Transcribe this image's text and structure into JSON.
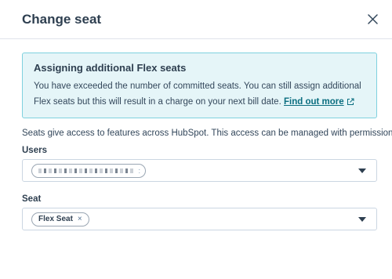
{
  "dialog": {
    "title": "Change seat",
    "close_icon": "close-icon"
  },
  "alert": {
    "title": "Assigning additional Flex seats",
    "body": "You have exceeded the number of committed seats. You can still assign additional Flex seats but this will result in a charge on your next bill date.",
    "link_label": "Find out more",
    "link_icon": "external-link-icon",
    "colors": {
      "background": "#e5f5f8",
      "border": "#7fd1de",
      "link": "#0b6e80"
    }
  },
  "info_text": "Seats give access to features across HubSpot. This access can be managed with permissions.",
  "users_field": {
    "label": "Users",
    "selected_tag": {
      "remove_symbol": ":"
    },
    "caret_icon": "caret-down-icon"
  },
  "seat_field": {
    "label": "Seat",
    "selected_tag": {
      "label": "Flex Seat",
      "remove_symbol": "×"
    },
    "caret_icon": "caret-down-icon"
  }
}
